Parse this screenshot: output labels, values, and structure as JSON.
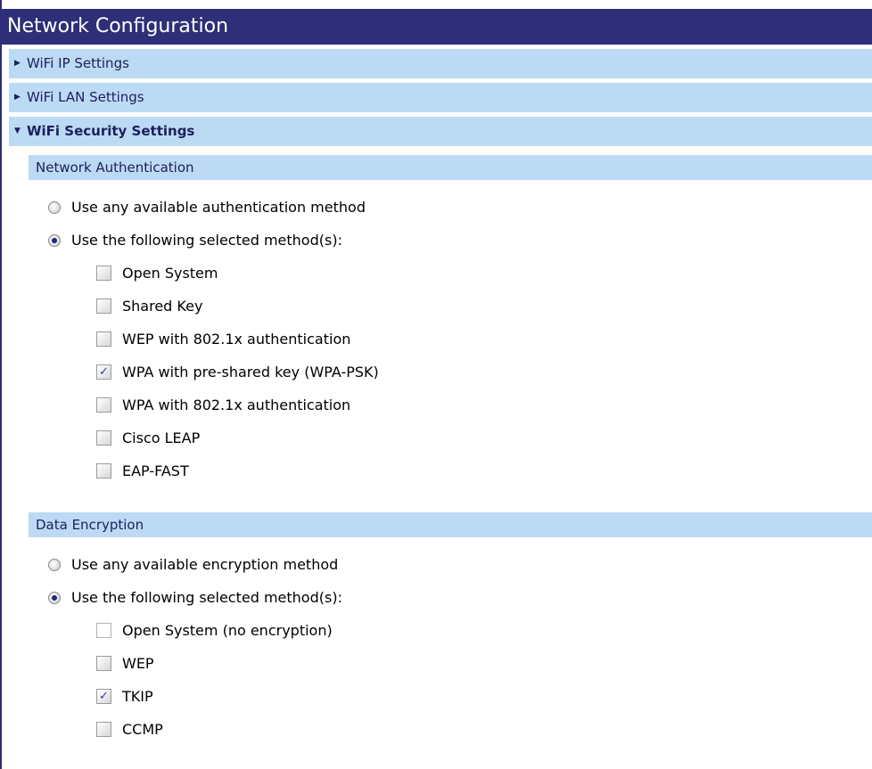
{
  "title": "Network Configuration",
  "accordion": [
    {
      "label": "WiFi IP Settings",
      "open": false
    },
    {
      "label": "WiFi LAN Settings",
      "open": false
    },
    {
      "label": "WiFi Security Settings",
      "open": true
    }
  ],
  "network_auth": {
    "heading": "Network Authentication",
    "radio_any": "Use any available authentication method",
    "radio_selected": "Use the following selected method(s):",
    "selected_radio": "selected",
    "methods": [
      {
        "label": "Open System",
        "checked": false
      },
      {
        "label": "Shared Key",
        "checked": false
      },
      {
        "label": "WEP with 802.1x authentication",
        "checked": false
      },
      {
        "label": "WPA with pre-shared key (WPA-PSK)",
        "checked": true
      },
      {
        "label": "WPA with 802.1x authentication",
        "checked": false
      },
      {
        "label": "Cisco LEAP",
        "checked": false
      },
      {
        "label": "EAP-FAST",
        "checked": false
      }
    ]
  },
  "data_encryption": {
    "heading": "Data Encryption",
    "radio_any": "Use any available encryption method",
    "radio_selected": "Use the following selected method(s):",
    "selected_radio": "selected",
    "methods": [
      {
        "label": "Open System (no encryption)",
        "checked": false
      },
      {
        "label": "WEP",
        "checked": false
      },
      {
        "label": "TKIP",
        "checked": true
      },
      {
        "label": "CCMP",
        "checked": false
      }
    ]
  },
  "colors": {
    "title_bg": "#2e2f78",
    "section_bg": "#bcdaf4",
    "text_dark": "#1d1f5c"
  }
}
